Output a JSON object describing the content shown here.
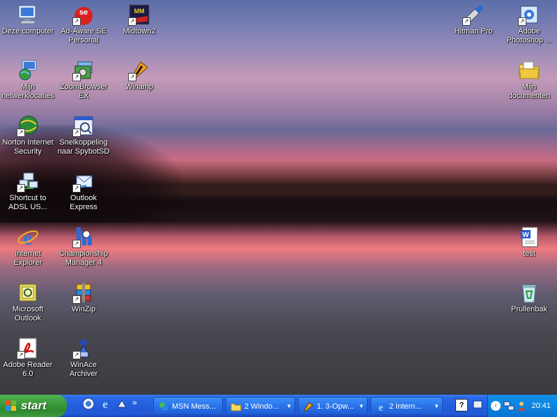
{
  "desktop": {
    "icons_left": [
      {
        "label": "Deze computer"
      },
      {
        "label": "Mijn netwerklocaties"
      },
      {
        "label": "Norton Internet Security"
      },
      {
        "label": "Shortcut to ADSL US..."
      },
      {
        "label": "Internet Explorer"
      },
      {
        "label": "Microsoft Outlook"
      },
      {
        "label": "Adobe Reader 6.0"
      }
    ],
    "icons_left2": [
      {
        "label": "Ad-Aware SE Personal"
      },
      {
        "label": "ZoomBrowser EX"
      },
      {
        "label": "Snelkoppeling naar SpybotSD"
      },
      {
        "label": "Outlook Express"
      },
      {
        "label": "Championship Manager 4"
      },
      {
        "label": "WinZip"
      },
      {
        "label": "WinAce Archiver"
      }
    ],
    "icon_midtown": {
      "label": "Midtown2"
    },
    "icon_winamp": {
      "label": "Winamp"
    },
    "icons_right": [
      {
        "label": "Hitman Pro"
      },
      {
        "label": "Adobe Photoshop ..."
      },
      {
        "label": "Mijn documenten"
      },
      {
        "label": "test"
      },
      {
        "label": "Prullenbak"
      }
    ]
  },
  "taskbar": {
    "start_label": "start",
    "tasks": [
      {
        "label": "MSN Mess..."
      },
      {
        "label": "2 Windo..."
      },
      {
        "label": "1. 3-Opw..."
      },
      {
        "label": "2 Intern..."
      }
    ],
    "ql_more": "»",
    "clock": "20:41"
  }
}
